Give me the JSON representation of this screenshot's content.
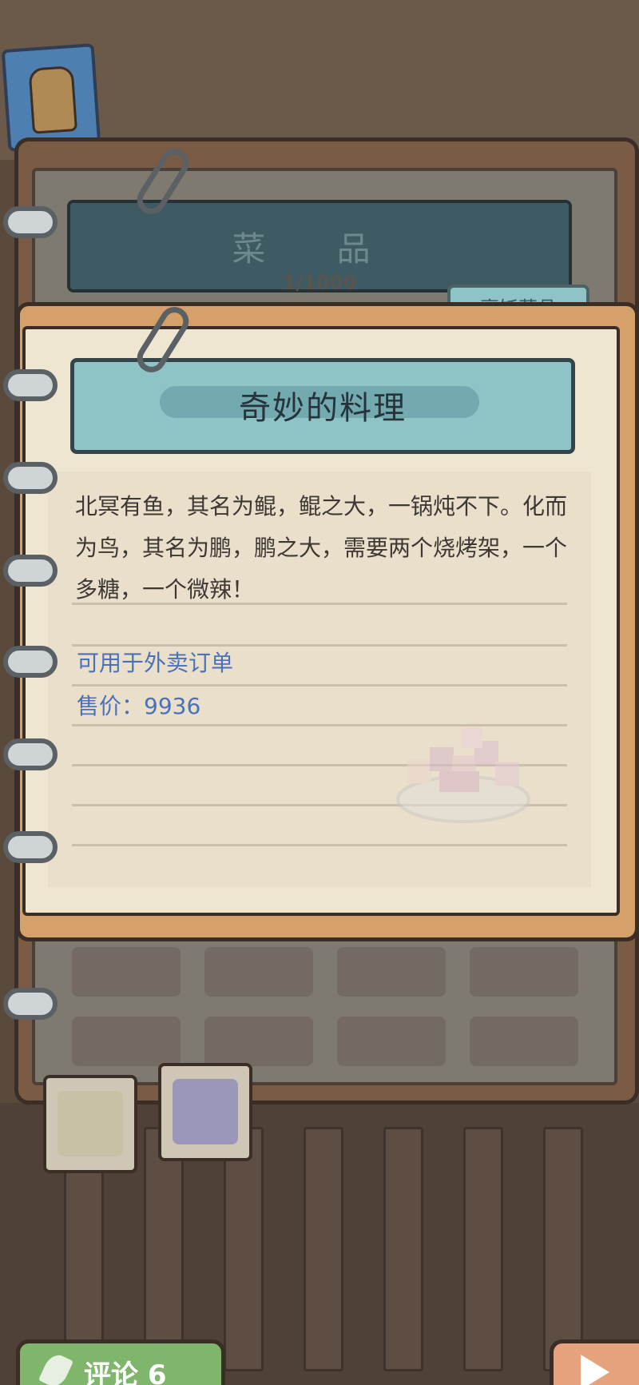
{
  "catalog": {
    "title": "菜 品",
    "count": "1/1000"
  },
  "tabs": {
    "cooking_dishes": "烹饪菜品"
  },
  "dish_card": {
    "name": "奇妙的料理",
    "description": "北冥有鱼，其名为鲲，鲲之大，一锅炖不下。化而为鸟，其名为鹏，鹏之大，需要两个烧烤架，一个多糖，一个微辣！",
    "delivery_note": "可用于外卖订单",
    "price": "售价：9936",
    "illustration_icon": "mystery-dish-icon"
  },
  "bottom_tabs": [
    {
      "icon": "dish-bowl-icon"
    },
    {
      "icon": "roast-chicken-icon"
    }
  ],
  "buttons": {
    "review_label": "评论 6",
    "review_icon": "feather-icon",
    "next_icon": "arrow-right-icon"
  },
  "colors": {
    "banner_teal": "#8fc4c6",
    "info_blue": "#4a72b8",
    "review_green": "#80b56c",
    "next_orange": "#e6a27d"
  }
}
